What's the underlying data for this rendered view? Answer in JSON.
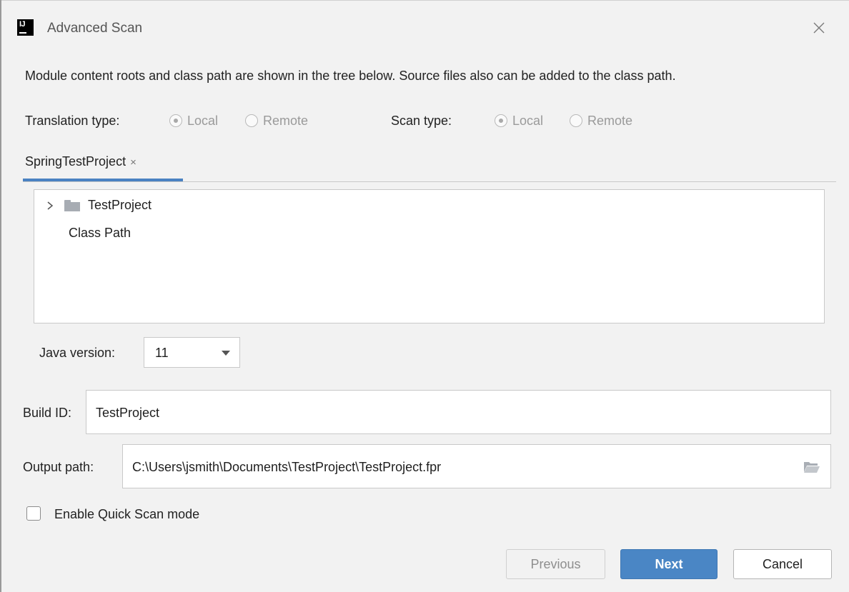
{
  "window": {
    "title": "Advanced Scan",
    "app_icon": "intellij-icon",
    "close_icon": "close-icon"
  },
  "description": "Module content roots and class path are shown in the tree below. Source files also can be added to the class path.",
  "translation_type": {
    "label": "Translation type:",
    "options": [
      "Local",
      "Remote"
    ],
    "selected": "Local",
    "enabled": false
  },
  "scan_type": {
    "label": "Scan type:",
    "options": [
      "Local",
      "Remote"
    ],
    "selected": "Local",
    "enabled": false
  },
  "tabs": [
    {
      "label": "SpringTestProject",
      "close_glyph": "×",
      "active": true
    }
  ],
  "tree": {
    "items": [
      {
        "label": "TestProject",
        "icon": "folder-icon",
        "expandable": true
      },
      {
        "label": "Class Path"
      }
    ]
  },
  "java_version": {
    "label": "Java version:",
    "value": "11"
  },
  "build_id": {
    "label": "Build ID:",
    "value": "TestProject"
  },
  "output_path": {
    "label": "Output path:",
    "value": "C:\\Users\\jsmith\\Documents\\TestProject\\TestProject.fpr",
    "browse_icon": "folder-open-icon"
  },
  "quick_scan": {
    "label": "Enable Quick Scan mode",
    "checked": false
  },
  "buttons": {
    "previous": "Previous",
    "next": "Next",
    "cancel": "Cancel"
  },
  "colors": {
    "accent": "#4a86c5",
    "tab_underline": "#4a82c2",
    "background": "#f2f2f2"
  }
}
